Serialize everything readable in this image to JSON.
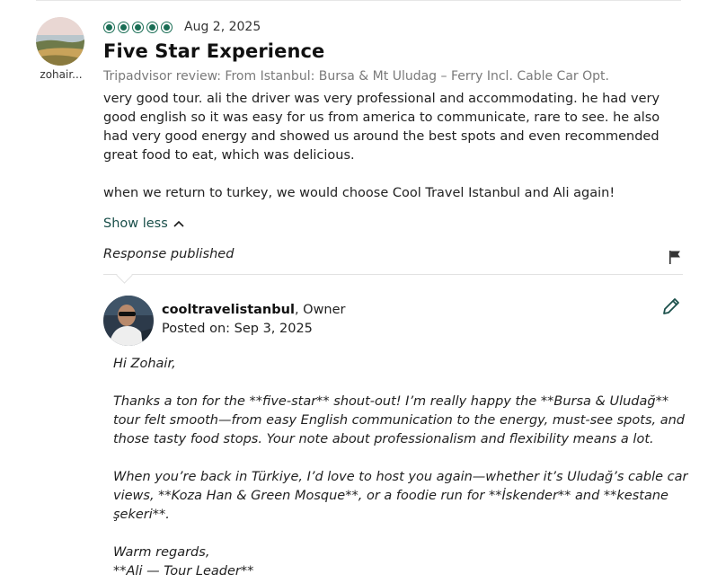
{
  "review": {
    "reviewer_name": "zohair...",
    "rating": 5,
    "date": "Aug 2, 2025",
    "title": "Five Star Experience",
    "source": "Tripadvisor review: From Istanbul: Bursa & Mt Uludag – Ferry Incl. Cable Car Opt.",
    "body_p1": "very good tour. ali the driver was very professional and accommodating. he had very good english so it was easy for us from america to communicate, rare to see. he also had very good energy and showed us around the best spots and even recommended great food to eat, which was delicious.",
    "body_p2": "when we return to turkey, we would choose Cool Travel Istanbul and Ali again!",
    "show_less_label": "Show less"
  },
  "response": {
    "status_label": "Response published",
    "owner_name": "cooltravelistanbul",
    "owner_role": ", Owner",
    "posted_label": "Posted on: Sep 3, 2025",
    "greeting": "Hi Zohair,",
    "p1": "Thanks a ton for the **five-star** shout-out! I’m really happy the **Bursa & Uludağ** tour felt smooth—from easy English communication to the energy, must-see spots, and those tasty food stops. Your note about professionalism and flexibility means a lot.",
    "p2": "When you’re back in Türkiye, I’d love to host you again—whether it’s Uludağ’s cable car views, **Koza Han & Green Mosque**, or a foodie run for **İskender** and **kestane şekeri**.",
    "closing": "Warm regards,",
    "signature": "**Ali — Tour Leader**"
  },
  "colors": {
    "rating_green": "#1a6e55",
    "link_teal": "#1a4f4a",
    "muted_text": "#7a7a7a"
  }
}
